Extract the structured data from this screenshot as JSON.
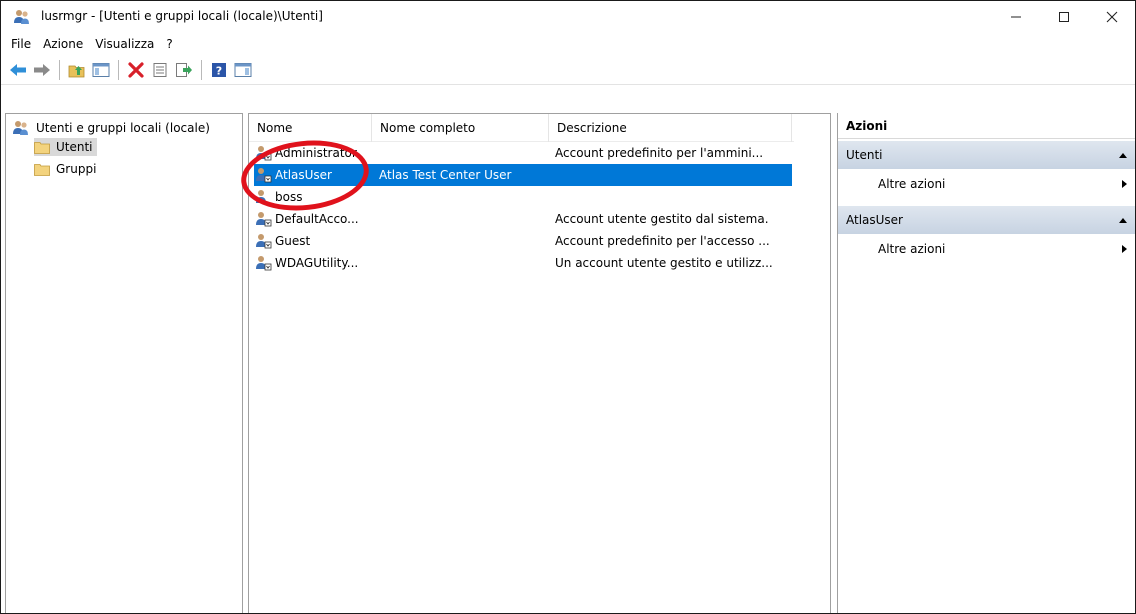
{
  "window": {
    "title": "lusrmgr - [Utenti e gruppi locali (locale)\\Utenti]",
    "controls": {
      "minimize": "—",
      "maximize": "☐",
      "close": "✕"
    }
  },
  "menu": [
    "File",
    "Azione",
    "Visualizza",
    "?"
  ],
  "toolbar": {
    "icons": [
      "back-arrow-icon",
      "forward-arrow-icon",
      "up-folder-icon",
      "show-hide-tree-icon",
      "delete-icon",
      "properties-icon",
      "export-list-icon",
      "help-icon",
      "show-hide-action-pane-icon"
    ]
  },
  "tree": {
    "root": "Utenti e gruppi locali (locale)",
    "children": [
      {
        "label": "Utenti",
        "selected": true
      },
      {
        "label": "Gruppi",
        "selected": false
      }
    ]
  },
  "list": {
    "columns": [
      "Nome",
      "Nome completo",
      "Descrizione"
    ],
    "rows": [
      {
        "nome": "Administrator",
        "completo": "",
        "desc": "Account predefinito per l'ammini...",
        "selected": false
      },
      {
        "nome": "AtlasUser",
        "completo": "Atlas Test Center User",
        "desc": "",
        "selected": true
      },
      {
        "nome": "boss",
        "completo": "",
        "desc": "",
        "selected": false
      },
      {
        "nome": "DefaultAcco...",
        "completo": "",
        "desc": "Account utente gestito dal sistema.",
        "selected": false
      },
      {
        "nome": "Guest",
        "completo": "",
        "desc": "Account predefinito per l'accesso ...",
        "selected": false
      },
      {
        "nome": "WDAGUtility...",
        "completo": "",
        "desc": "Un account utente gestito e utilizz...",
        "selected": false
      }
    ]
  },
  "actions": {
    "header": "Azioni",
    "sections": [
      {
        "title": "Utenti",
        "item": "Altre azioni"
      },
      {
        "title": "AtlasUser",
        "item": "Altre azioni"
      }
    ]
  },
  "colors": {
    "selection": "#0078d7",
    "tree_selection": "#d9d9d9",
    "annotation": "#e0121c",
    "action_section": "#c7d3e2"
  }
}
